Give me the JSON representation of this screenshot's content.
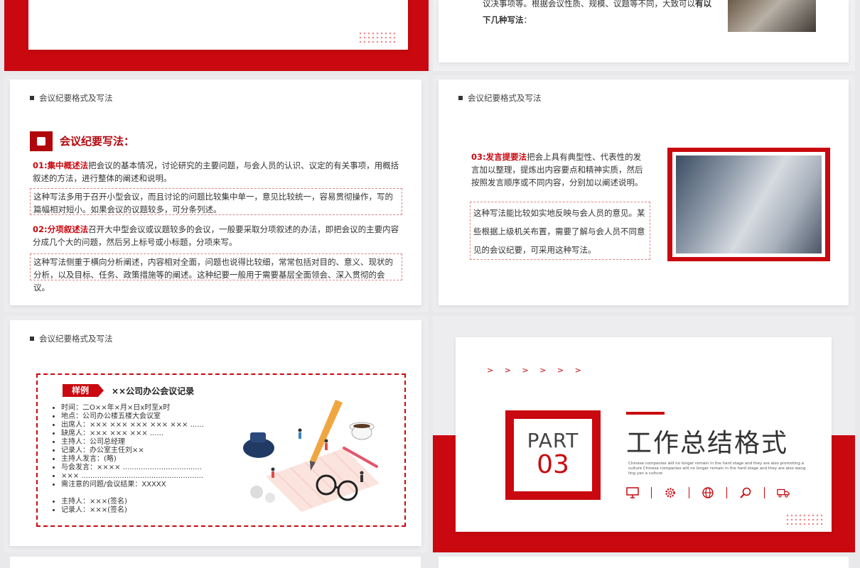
{
  "slide2": {
    "line1": "议决事项等。根据会议性质、规模、议题等不同，大致可以",
    "line1_bold": "有以",
    "line2_bold": "下几种写法",
    "line2_tail": "："
  },
  "slide3": {
    "header": "会议纪要格式及写法",
    "title": "会议纪要写法：",
    "p1_label": "01:集中概述法",
    "p1_text": "把会议的基本情况，讨论研究的主要问题，与会人员的认识、议定的有关事项，用概括叙述的方法，进行整体的阐述和说明。",
    "box1": "这种写法多用于召开小型会议，而且讨论的问题比较集中单一，意见比较统一，容易贯彻操作，写的篇幅相对短小。如果会议的议题较多，可分条列述。",
    "p2_label": "02:分项叙述法",
    "p2_text": "召开大中型会议或议题较多的会议，一般要采取分项叙述的办法，即把会议的主要内容分成几个大的问题，然后另上标号或小标题，分项来写。",
    "box2": "这种写法侧重于横向分析阐述，内容相对全面，问题也说得比较细，常常包括对目的、意义、现状的分析，以及目标、任务、政策措施等的阐述。这种纪要一般用于需要基层全面领会、深入贯彻的会议。"
  },
  "slide4": {
    "header": "会议纪要格式及写法",
    "p3_label": "03:发言提要法",
    "p3_text": "把会上具有典型性、代表性的发言加以整理，提炼出内容要点和精神实质，然后按照发言顺序或不同内容，分别加以阐述说明。",
    "box3": "这种写法能比较如实地反映与会人员的意见。某些根据上级机关布置，需要了解与会人员不同意见的会议纪要，可采用这种写法。"
  },
  "slide5": {
    "header": "会议纪要格式及写法",
    "tag": "样例",
    "record_title": "××公司办公会议记录",
    "items": [
      "时间：二O××年×月×日x时至x时",
      "地点：公司办公楼五楼大会议室",
      "出席人：××× ××× ××× ××× ××× ......",
      "缺席人：××× ××× ××× ......",
      "主持人：公司总经理",
      "记录人：办公室主任刘××",
      "主持人发言：(略)",
      "与会发言：×××× ...................................",
      "××× ......................................................",
      "需注意的问题/会议结果：XXXXX"
    ],
    "signatures": [
      "主持人：×××(签名)",
      "记录人：×××(签名)"
    ]
  },
  "slide6": {
    "arrows": "> > > > > >",
    "part": "PART",
    "number": "03",
    "title": "工作总结格式",
    "english": "Chinese  companies  will no longer remain in the hard stage and they are also promoting a culture Chinese  companies  will no longer remain in the hard stage and they are also wang ling yan a culture",
    "icons": [
      "monitor-icon",
      "gear-icon",
      "globe-icon",
      "search-icon",
      "truck-icon"
    ]
  },
  "colors": {
    "accent": "#c9080f"
  }
}
